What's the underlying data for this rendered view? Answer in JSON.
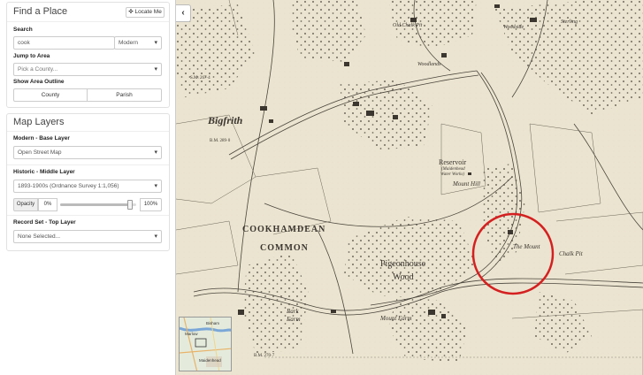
{
  "find_place": {
    "title": "Find a Place",
    "locate_label": "Locate Me",
    "search_label": "Search",
    "search_value": "cook",
    "search_mode": "Modern",
    "jump_label": "Jump to Area",
    "county_placeholder": "Pick a County...",
    "outline_label": "Show Area Outline",
    "outline_county": "County",
    "outline_parish": "Parish"
  },
  "map_layers": {
    "title": "Map Layers",
    "base_label": "Modern - Base Layer",
    "base_value": "Open Street Map",
    "historic_label": "Historic - Middle Layer",
    "historic_value": "1893-1900s (Ordnance Survey 1:1,056)",
    "opacity_label": "Opacity",
    "opacity_min": "0%",
    "opacity_max": "100%",
    "opacity_level": 0.92,
    "record_label": "Record Set - Top Layer",
    "record_value": "None Selected..."
  },
  "map": {
    "labels": {
      "bigfrith": "Bigfrith",
      "cookhamdean": "COOKHAMDEAN",
      "common": "COMMON",
      "pigeonhouse": "Pigeonhouse",
      "wood": "Wood",
      "reservoir": "Reservoir",
      "reservoir_sub1": "(Maidenhead",
      "reservoir_sub2": "Water Works)",
      "mount_hill": "Mount Hill",
      "the_mount": "The Mount",
      "chalk_pit": "Chalk Pit",
      "park_farm": "Park",
      "park_farm2": "Farm",
      "mount_farm": "Mount Farm",
      "woodlands": "Woodlands",
      "old_chalk_pit": "Old Chalk Pit",
      "sterling": "Sterling",
      "woodside": "Woodside",
      "bm1": "B.M. 289·0",
      "bm2": "S.M. 267·4",
      "bm3": "B.M. 270·7"
    },
    "highlight_color": "#d42020",
    "collapse_icon": "chevron-left-icon"
  },
  "minimap": {
    "label1": "Marlow",
    "label2": "Maidenhead",
    "label3": "Bisham"
  }
}
